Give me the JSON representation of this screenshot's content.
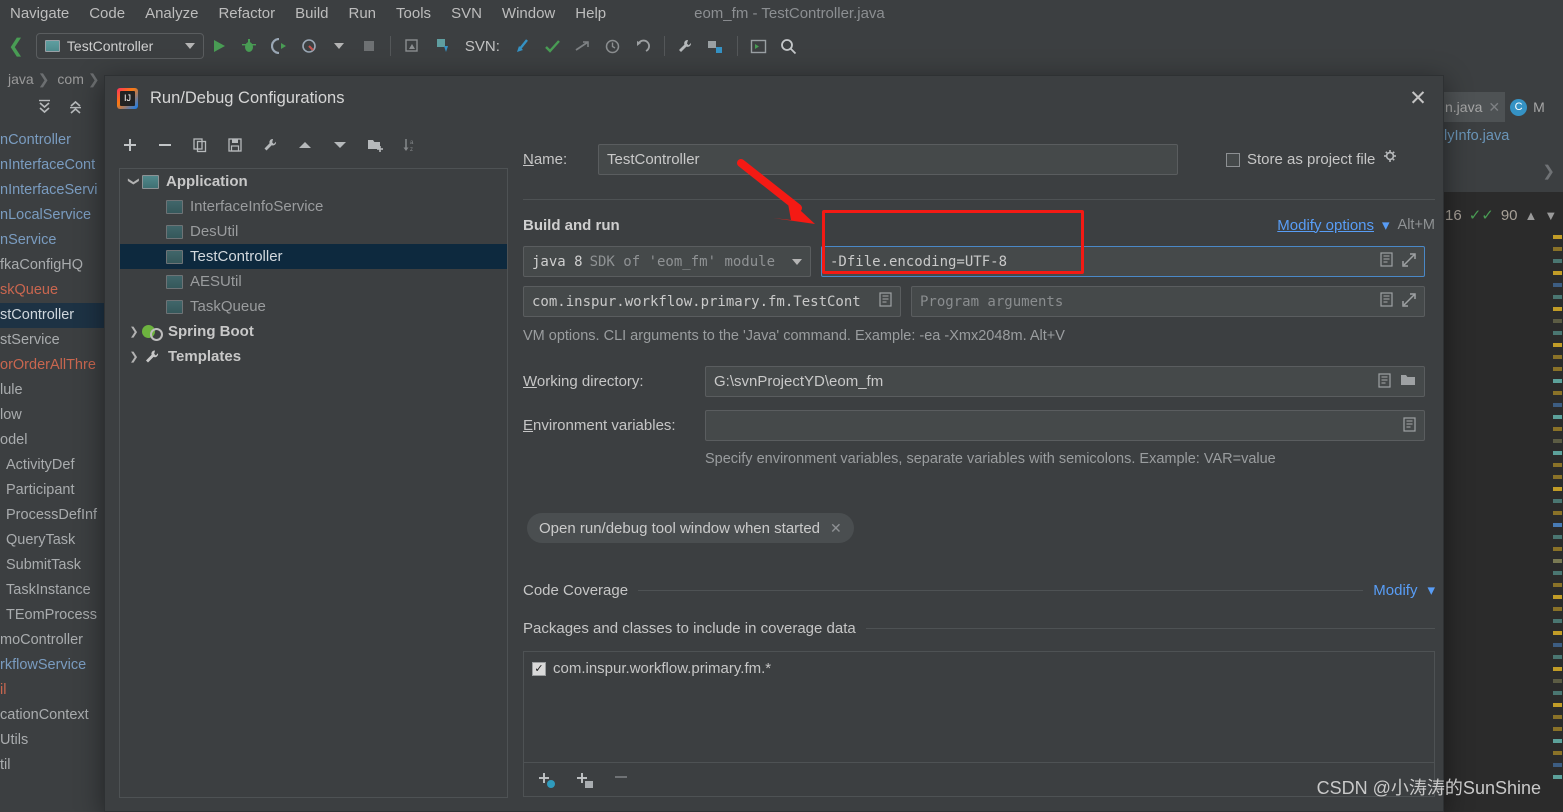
{
  "ide": {
    "menus": [
      "Navigate",
      "Code",
      "Analyze",
      "Refactor",
      "Build",
      "Run",
      "Tools",
      "SVN",
      "Window",
      "Help"
    ],
    "window_title": "eom_fm - TestController.java",
    "toolbar": {
      "run_config_name": "TestController",
      "svn_label": "SVN:"
    },
    "breadcrumb": [
      "java",
      "com"
    ],
    "left_tree_items": [
      {
        "label": "nController",
        "color": "blue"
      },
      {
        "label": "nInterfaceCont",
        "color": "blue"
      },
      {
        "label": "nInterfaceServi",
        "color": "blue"
      },
      {
        "label": "nLocalService",
        "color": "blue"
      },
      {
        "label": "nService",
        "color": "blue"
      },
      {
        "label": "fkaConfigHQ",
        "color": "grey"
      },
      {
        "label": "skQueue",
        "color": "red"
      },
      {
        "label": "stController",
        "color": "grey",
        "selected": true
      },
      {
        "label": "stService",
        "color": "grey"
      },
      {
        "label": "orOrderAllThre",
        "color": "red"
      },
      {
        "label": "lule",
        "color": "grey"
      },
      {
        "label": "low",
        "color": "grey"
      },
      {
        "label": "odel",
        "color": "grey"
      },
      {
        "label": "ActivityDef",
        "color": "grey",
        "indent": true
      },
      {
        "label": "Participant",
        "color": "grey",
        "indent": true
      },
      {
        "label": "ProcessDefInf",
        "color": "grey",
        "indent": true
      },
      {
        "label": "QueryTask",
        "color": "grey",
        "indent": true
      },
      {
        "label": "SubmitTask",
        "color": "grey",
        "indent": true
      },
      {
        "label": "TaskInstance",
        "color": "grey",
        "indent": true
      },
      {
        "label": "TEomProcess",
        "color": "grey",
        "indent": true
      },
      {
        "label": "moController",
        "color": "grey"
      },
      {
        "label": "rkflowService",
        "color": "blue"
      },
      {
        "label": "",
        "color": "grey"
      },
      {
        "label": "il",
        "color": "red"
      },
      {
        "label": "cationContext",
        "color": "grey"
      },
      {
        "label": "Utils",
        "color": "grey"
      },
      {
        "label": "til",
        "color": "grey"
      }
    ],
    "editor": {
      "tab_label": "n.java",
      "tab2_label": "M",
      "breadcrumb_file": "lyInfo.java",
      "inspection_count": "16",
      "inspection_score": "90"
    }
  },
  "dialog": {
    "title": "Run/Debug Configurations",
    "close_label": "✕",
    "tree_toolbar_icons": [
      "add-icon",
      "remove-icon",
      "copy-icon",
      "save-icon",
      "edit-templates-icon",
      "move-up-icon",
      "move-down-icon",
      "new-folder-icon",
      "sort-alpha-icon"
    ],
    "tree": [
      {
        "label": "Application",
        "level": 0,
        "expanded": true,
        "type": "group"
      },
      {
        "label": "InterfaceInfoService",
        "level": 1,
        "type": "item"
      },
      {
        "label": "DesUtil",
        "level": 1,
        "type": "item"
      },
      {
        "label": "TestController",
        "level": 1,
        "type": "item",
        "selected": true
      },
      {
        "label": "AESUtil",
        "level": 1,
        "type": "item"
      },
      {
        "label": "TaskQueue",
        "level": 1,
        "type": "item"
      },
      {
        "label": "Spring Boot",
        "level": 0,
        "expanded": false,
        "type": "spring"
      },
      {
        "label": "Templates",
        "level": 0,
        "expanded": false,
        "type": "templates"
      }
    ],
    "form": {
      "name_label": "Name:",
      "name_value": "TestController",
      "store_as_project_file_label": "Store as project file",
      "store_as_project_file_checked": false,
      "build_and_run_title": "Build and run",
      "modify_options_label": "Modify options",
      "modify_options_shortcut": "Alt+M",
      "jre_value_bold": "java 8",
      "jre_value_dim": "SDK of 'eom_fm' module",
      "vm_options_value": "-Dfile.encoding=UTF-8",
      "main_class_value": "com.inspur.workflow.primary.fm.TestCont",
      "program_arguments_placeholder": "Program arguments",
      "vm_hint": "VM options. CLI arguments to the 'Java' command. Example: -ea -Xmx2048m. Alt+V",
      "working_directory_label": "Working directory:",
      "working_directory_value": "G:\\svnProjectYD\\eom_fm",
      "environment_variables_label": "Environment variables:",
      "environment_variables_value": "",
      "environment_hint": "Specify environment variables, separate variables with semicolons. Example: VAR=value",
      "option_chip_label": "Open run/debug tool window when started",
      "option_chip_close": "✕",
      "code_coverage_title": "Code Coverage",
      "code_coverage_modify_label": "Modify",
      "coverage_packages_title": "Packages and classes to include in coverage data",
      "coverage_items": [
        {
          "label": "com.inspur.workflow.primary.fm.*",
          "checked": true
        }
      ]
    }
  },
  "annotation": {
    "highlight_color": "#f41a14",
    "arrow_color": "#f41a14"
  },
  "watermark": "CSDN @小涛涛的SunShine"
}
